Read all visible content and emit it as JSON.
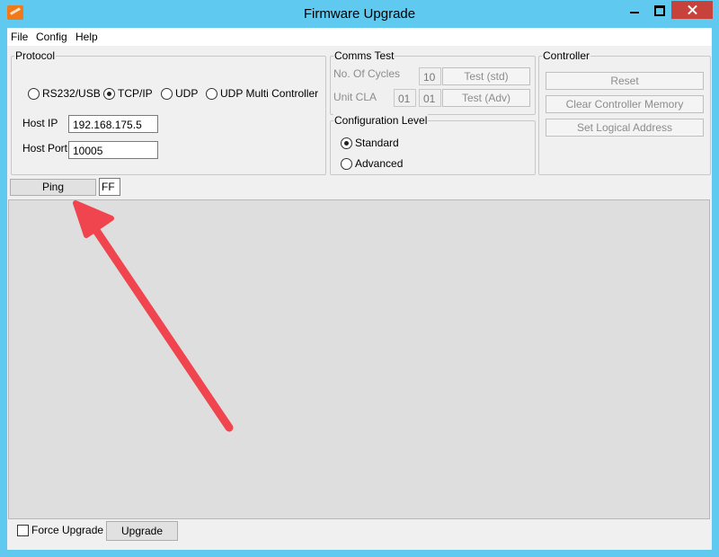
{
  "window": {
    "title": "Firmware Upgrade"
  },
  "menu": {
    "items": [
      "File",
      "Config",
      "Help"
    ]
  },
  "protocol": {
    "label": "Protocol",
    "options": [
      "RS232/USB",
      "TCP/IP",
      "UDP",
      "UDP Multi Controller"
    ],
    "selected": "TCP/IP",
    "host_ip_label": "Host IP",
    "host_ip_value": "192.168.175.5",
    "host_port_label": "Host Port",
    "host_port_value": "10005"
  },
  "comms_test": {
    "label": "Comms Test",
    "cycles_label": "No. Of Cycles",
    "cycles_value": "10",
    "test_std_label": "Test (std)",
    "unit_cla_label": "Unit CLA",
    "unit_cla_value1": "01",
    "unit_cla_value2": "01",
    "test_adv_label": "Test (Adv)"
  },
  "config_level": {
    "label": "Configuration Level",
    "options": [
      "Standard",
      "Advanced"
    ],
    "selected": "Standard"
  },
  "controller": {
    "label": "Controller",
    "reset_label": "Reset",
    "clear_memory_label": "Clear Controller Memory",
    "set_address_label": "Set Logical Address"
  },
  "ping": {
    "label": "Ping",
    "value": "FF"
  },
  "footer": {
    "force_upgrade_label": "Force Upgrade",
    "force_upgrade_checked": false,
    "upgrade_label": "Upgrade"
  },
  "colors": {
    "titlebar": "#5fc9ef",
    "close_button": "#c7423a",
    "arrow": "#f0444e",
    "panel": "#dedede"
  },
  "icons": {
    "app": "firmware-app-icon",
    "annotation": "red-arrow-annotation"
  }
}
